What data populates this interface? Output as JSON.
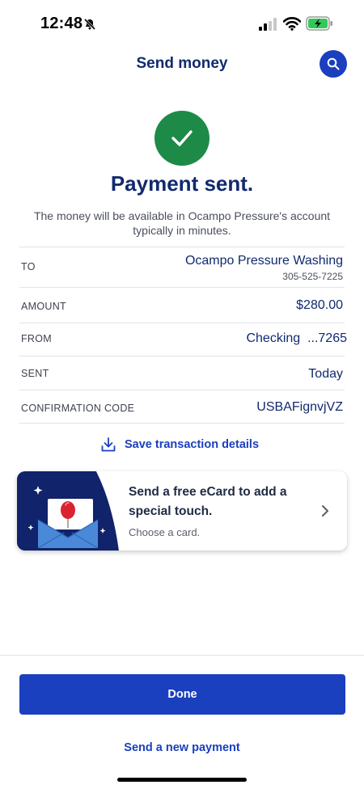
{
  "status_bar": {
    "time": "12:48",
    "icons": [
      "bell-slash-icon",
      "signal-icon",
      "wifi-icon",
      "battery-charging-icon"
    ]
  },
  "nav": {
    "title": "Send money",
    "search_icon": "search-icon"
  },
  "confirmation": {
    "icon": "check-icon",
    "headline": "Payment sent.",
    "message": "The money will be available in Ocampo Pressure's account typically in minutes."
  },
  "details": {
    "to": {
      "label": "TO",
      "name": "Ocampo Pressure Washing",
      "phone": "305-525-7225"
    },
    "amount": {
      "label": "AMOUNT",
      "value": "$280.00"
    },
    "from": {
      "label": "FROM",
      "value": "Checking  ...7265"
    },
    "sent": {
      "label": "SENT",
      "value": "Today"
    },
    "confirmation_code": {
      "label": "CONFIRMATION CODE",
      "value": "USBAFignvjVZ"
    }
  },
  "save_link": {
    "label": "Save transaction details",
    "icon": "download-icon"
  },
  "ecard": {
    "title": "Send a free eCard to add a special touch.",
    "subtitle": "Choose a card.",
    "icon": "chevron-right-icon"
  },
  "actions": {
    "done_label": "Done",
    "new_payment_label": "Send a new payment"
  },
  "colors": {
    "brand_blue": "#1a3fbf",
    "navy": "#112a6e",
    "success_green": "#1e8a47"
  }
}
